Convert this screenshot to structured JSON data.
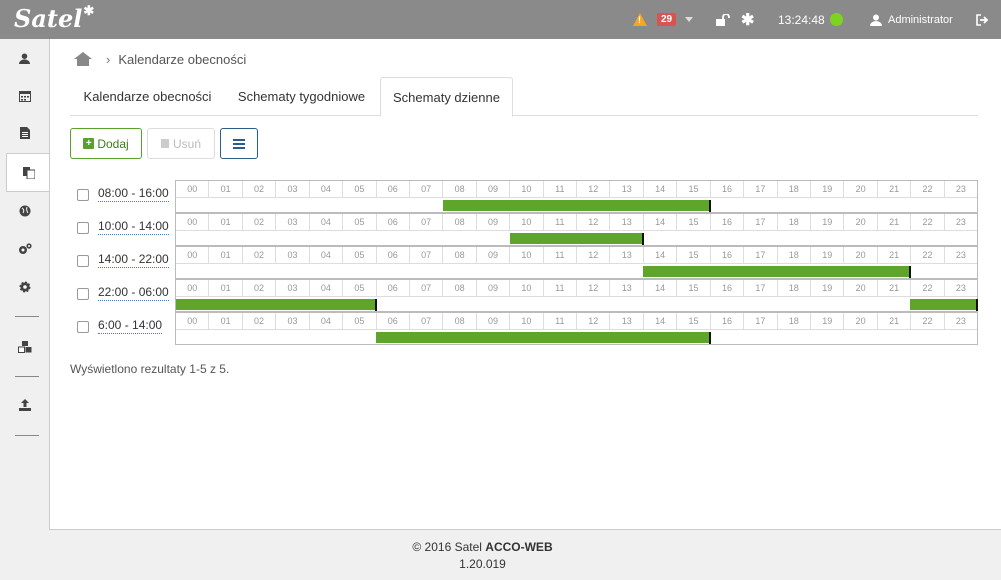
{
  "topbar": {
    "logo": "Satel",
    "logo_mark": "✱",
    "alarm_count": "29",
    "clock": "13:24:48",
    "user": "Administrator",
    "icons": [
      "warning-icon",
      "unlock-icon",
      "asterisk-icon",
      "status-dot-icon",
      "user-icon",
      "logout-icon"
    ]
  },
  "sidebar": {
    "items": [
      "user-icon",
      "calendar-icon",
      "document-icon",
      "copy-icon",
      "globe-icon",
      "gears-icon",
      "cog-icon",
      "cubes-icon",
      "upload-icon"
    ]
  },
  "breadcrumb": {
    "current": "Kalendarze obecności"
  },
  "tabs": [
    {
      "label": "Kalendarze obecności"
    },
    {
      "label": "Schematy tygodniowe"
    },
    {
      "label": "Schematy dzienne"
    }
  ],
  "toolbar": {
    "add_label": "Dodaj",
    "delete_label": "Usuń"
  },
  "hours": [
    "00",
    "01",
    "02",
    "03",
    "04",
    "05",
    "06",
    "07",
    "08",
    "09",
    "10",
    "11",
    "12",
    "13",
    "14",
    "15",
    "16",
    "17",
    "18",
    "19",
    "20",
    "21",
    "22",
    "23"
  ],
  "schedules": [
    {
      "label": "08:00 - 16:00",
      "ranges": [
        [
          8,
          16
        ]
      ]
    },
    {
      "label": "10:00 - 14:00",
      "ranges": [
        [
          10,
          14
        ]
      ]
    },
    {
      "label": "14:00 - 22:00",
      "ranges": [
        [
          14,
          22
        ]
      ]
    },
    {
      "label": "22:00 - 06:00",
      "ranges": [
        [
          0,
          6
        ],
        [
          22,
          24
        ]
      ]
    },
    {
      "label": "6:00 - 14:00",
      "ranges": [
        [
          6,
          16
        ]
      ]
    }
  ],
  "result_text": "Wyświetlono rezultaty 1-5 z 5.",
  "footer": {
    "copyright": "© 2016 Satel",
    "product": "ACCO-WEB",
    "version": "1.20.019"
  },
  "colors": {
    "topbar": "#8a8a8a",
    "accent_green": "#5fa52c",
    "alarm_badge": "#d9534f",
    "status_ok": "#7ed321"
  }
}
